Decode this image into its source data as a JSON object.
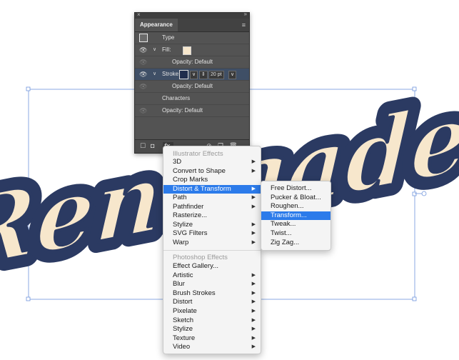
{
  "panel": {
    "close_glyph": "×",
    "collapse_glyph": "»",
    "tab_title": "Appearance",
    "menu_glyph": "≡",
    "rows": {
      "type_label": "Type",
      "fill_label": "Fill:",
      "fill_color": "#f7e7cc",
      "fill_opacity": "Opacity: Default",
      "stroke_label": "Stroke:",
      "stroke_color": "#1f2d4d",
      "stroke_weight": "20 pt",
      "stroke_opacity": "Opacity: Default",
      "characters": "Characters",
      "opacity": "Opacity: Default"
    },
    "fx_label": "fx."
  },
  "artwork": {
    "text": "Renegade",
    "fill_color": "#f7e7cc",
    "stroke_color": "#2b3a62"
  },
  "effects_menu": {
    "section1_header": "Illustrator Effects",
    "illustrator_items": [
      {
        "label": "3D",
        "submenu": true
      },
      {
        "label": "Convert to Shape",
        "submenu": true
      },
      {
        "label": "Crop Marks",
        "submenu": false
      },
      {
        "label": "Distort & Transform",
        "submenu": true,
        "highlighted": true
      },
      {
        "label": "Path",
        "submenu": true
      },
      {
        "label": "Pathfinder",
        "submenu": true
      },
      {
        "label": "Rasterize...",
        "submenu": false
      },
      {
        "label": "Stylize",
        "submenu": true
      },
      {
        "label": "SVG Filters",
        "submenu": true
      },
      {
        "label": "Warp",
        "submenu": true
      }
    ],
    "section2_header": "Photoshop Effects",
    "photoshop_items": [
      {
        "label": "Effect Gallery...",
        "submenu": false
      },
      {
        "label": "Artistic",
        "submenu": true
      },
      {
        "label": "Blur",
        "submenu": true
      },
      {
        "label": "Brush Strokes",
        "submenu": true
      },
      {
        "label": "Distort",
        "submenu": true
      },
      {
        "label": "Pixelate",
        "submenu": true
      },
      {
        "label": "Sketch",
        "submenu": true
      },
      {
        "label": "Stylize",
        "submenu": true
      },
      {
        "label": "Texture",
        "submenu": true
      },
      {
        "label": "Video",
        "submenu": true
      }
    ]
  },
  "distort_submenu": {
    "items": [
      {
        "label": "Free Distort...",
        "highlighted": false
      },
      {
        "label": "Pucker & Bloat...",
        "highlighted": false
      },
      {
        "label": "Roughen...",
        "highlighted": false
      },
      {
        "label": "Transform...",
        "highlighted": true
      },
      {
        "label": "Tweak...",
        "highlighted": false
      },
      {
        "label": "Twist...",
        "highlighted": false
      },
      {
        "label": "Zig Zag...",
        "highlighted": false
      }
    ]
  },
  "colors": {
    "menu_highlight": "#2c7bea",
    "selection_blue": "#4a7bd8"
  }
}
